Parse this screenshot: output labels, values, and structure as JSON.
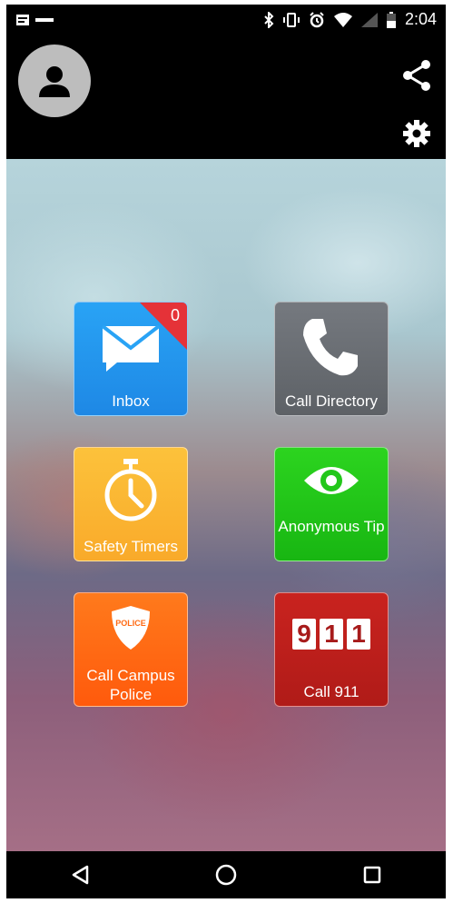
{
  "status_bar": {
    "time": "2:04",
    "icons": [
      "notification-icon",
      "app-notification-icon",
      "bluetooth-icon",
      "vibrate-icon",
      "alarm-icon",
      "wifi-icon",
      "signal-icon",
      "battery-icon"
    ]
  },
  "header": {
    "avatar_icon": "person-icon",
    "share_icon": "share-icon",
    "settings_icon": "gear-icon"
  },
  "tiles": [
    {
      "label": "Inbox",
      "icon": "envelope-icon",
      "color": "#2196f3",
      "badge": "0"
    },
    {
      "label": "Call Directory",
      "icon": "phone-icon",
      "color": "#666a70"
    },
    {
      "label": "Safety Timers",
      "icon": "stopwatch-icon",
      "color": "#fbb632"
    },
    {
      "label": "Anonymous Tip",
      "icon": "eye-icon",
      "color": "#22c71a"
    },
    {
      "label": "Call Campus Police",
      "icon": "police-badge-icon",
      "color": "#ff6a13",
      "badge_text": "POLICE"
    },
    {
      "label": "Call 911",
      "icon": "911-icon",
      "color": "#c0211f",
      "digits": [
        "9",
        "1",
        "1"
      ]
    }
  ],
  "navbar": {
    "back_icon": "back-icon",
    "home_icon": "home-icon",
    "recents_icon": "recents-icon"
  }
}
